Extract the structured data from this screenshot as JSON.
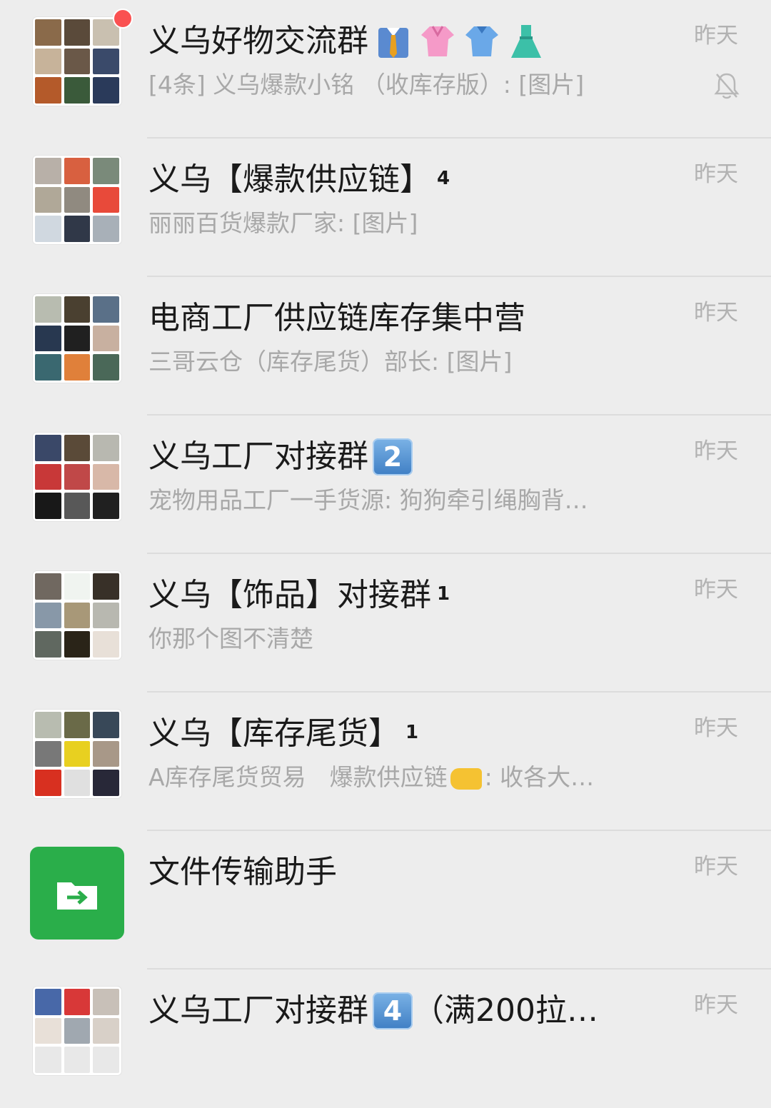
{
  "chats": [
    {
      "title": "义乌好物交流群",
      "title_emojis": [
        "necktie-shirt-emoji",
        "blouse-emoji",
        "polo-shirt-emoji",
        "dress-emoji"
      ],
      "preview": "[4条] 义乌爆款小铭 （收库存版）: [图片]",
      "time": "昨天",
      "unread_dot": true,
      "muted": true,
      "avatar_colors": [
        "#8a6a4a",
        "#5a4a3a",
        "#c9c0b0",
        "#c7b39a",
        "#6a5848",
        "#3a4a6a",
        "#b45a2a",
        "#3a5a3a",
        "#2a3a5a"
      ]
    },
    {
      "title": "义乌【爆款供应链】",
      "sup": "4",
      "preview": "丽丽百货爆款厂家: [图片]",
      "time": "昨天",
      "avatar_colors": [
        "#b8b0a8",
        "#d86040",
        "#7a8a7a",
        "#b0a898",
        "#908a80",
        "#e84a3a",
        "#d0d8e0",
        "#303848",
        "#a8b0b8"
      ]
    },
    {
      "title": "电商工厂供应链库存集中营",
      "preview": "三哥云仓（库存尾货）部长: [图片]",
      "time": "昨天",
      "avatar_colors": [
        "#b8bcb0",
        "#4a4030",
        "#5a7088",
        "#283850",
        "#202020",
        "#c8b0a0",
        "#3a6870",
        "#e0803a",
        "#4a6858"
      ]
    },
    {
      "title": "义乌工厂对接群",
      "badge": "2",
      "preview": "宠物用品工厂一手货源: 狗狗牵引绳胸背…",
      "time": "昨天",
      "avatar_colors": [
        "#3a4868",
        "#5a4a38",
        "#b8b8b0",
        "#c83838",
        "#c04848",
        "#d8b8a8",
        "#181818",
        "#585858",
        "#202020"
      ]
    },
    {
      "title": "义乌【饰品】对接群",
      "sup": "1",
      "preview": "你那个图不清楚",
      "time": "昨天",
      "avatar_colors": [
        "#706860",
        "#f0f4f0",
        "#383028",
        "#8898a8",
        "#a89878",
        "#b8b8b0",
        "#606860",
        "#2a2418",
        "#e8e0d8"
      ]
    },
    {
      "title": "义乌【库存尾货】",
      "sup": "1",
      "preview_parts": [
        "A库存尾货贸易　爆款供应链",
        "pointing-hand-emoji",
        ": 收各大…"
      ],
      "preview_prefix": "A库存尾货贸易　爆款供应链",
      "preview_suffix": ": 收各大…",
      "time": "昨天",
      "avatar_colors": [
        "#b8bcb0",
        "#6a6a48",
        "#384858",
        "#787878",
        "#e8d020",
        "#a89888",
        "#d83020",
        "#e0e0e0",
        "#282838"
      ]
    },
    {
      "title": "文件传输助手",
      "preview": "",
      "time": "昨天",
      "avatar_icon": "folder-arrow-icon"
    },
    {
      "title": "义乌工厂对接群",
      "badge": "4",
      "title_suffix": "（满200拉…",
      "time": "昨天",
      "avatar_colors": [
        "#4868a8",
        "#d83838",
        "#c8c0b8",
        "#e8e0d8",
        "#a0a8b0",
        "#d8d0c8",
        "#e8e8e8",
        "#e8e8e8",
        "#e8e8e8"
      ]
    }
  ]
}
